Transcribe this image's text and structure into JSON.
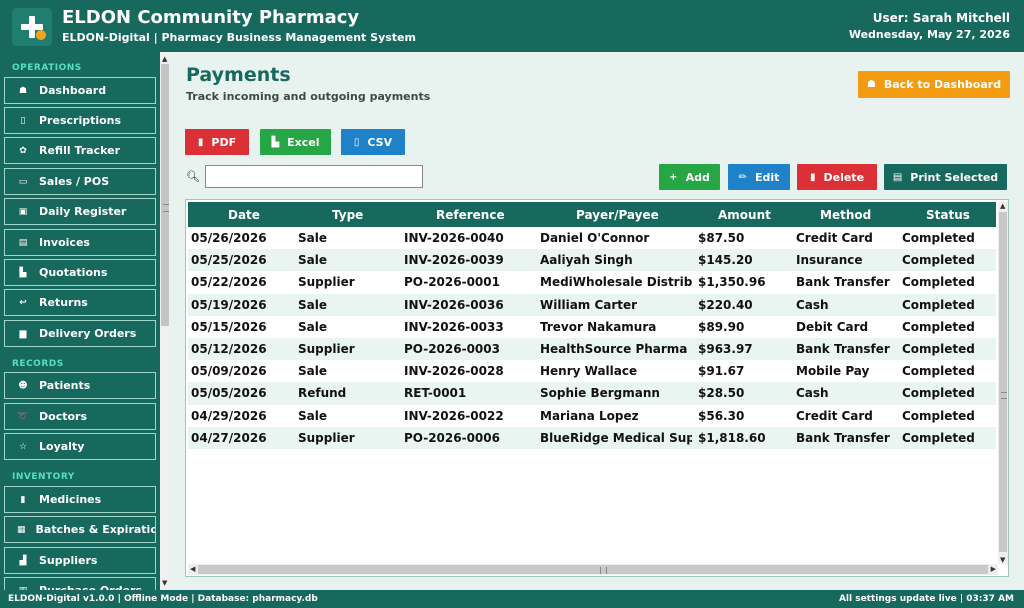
{
  "header": {
    "title": "ELDON Community Pharmacy",
    "subtitle": "ELDON-Digital  |  Pharmacy Business Management System",
    "user": "User: Sarah Mitchell",
    "date": "Wednesday, May 27, 2026"
  },
  "sidebar": {
    "sections": {
      "operations": "OPERATIONS",
      "records": "RECORDS",
      "inventory": "INVENTORY"
    },
    "items": [
      {
        "label": "Dashboard",
        "icon": "house-icon",
        "glyph": "☗"
      },
      {
        "label": "Prescriptions",
        "icon": "clipboard-icon",
        "glyph": "▯"
      },
      {
        "label": "Refill Tracker",
        "icon": "refresh-icon",
        "glyph": "✿"
      },
      {
        "label": "Sales / POS",
        "icon": "card-icon",
        "glyph": "▭"
      },
      {
        "label": "Daily Register",
        "icon": "register-icon",
        "glyph": "▣"
      },
      {
        "label": "Invoices",
        "icon": "invoice-icon",
        "glyph": "▤"
      },
      {
        "label": "Quotations",
        "icon": "quote-icon",
        "glyph": "▙"
      },
      {
        "label": "Returns",
        "icon": "return-icon",
        "glyph": "↩"
      },
      {
        "label": "Delivery Orders",
        "icon": "truck-icon",
        "glyph": "▆"
      },
      {
        "label": "Patients",
        "icon": "patients-icon",
        "glyph": "☻"
      },
      {
        "label": "Doctors",
        "icon": "stethoscope-icon",
        "glyph": "➰"
      },
      {
        "label": "Loyalty",
        "icon": "star-icon",
        "glyph": "☆"
      },
      {
        "label": "Medicines",
        "icon": "pill-icon",
        "glyph": "▮"
      },
      {
        "label": "Batches & Expiration",
        "icon": "batch-icon",
        "glyph": "▦"
      },
      {
        "label": "Suppliers",
        "icon": "factory-icon",
        "glyph": "▟"
      },
      {
        "label": "Purchase Orders",
        "icon": "cart-icon",
        "glyph": "▥"
      }
    ]
  },
  "page": {
    "title": "Payments",
    "subtitle": "Track incoming and outgoing payments",
    "back_label": "Back to Dashboard"
  },
  "export": {
    "pdf": "PDF",
    "excel": "Excel",
    "csv": "CSV"
  },
  "search": {
    "value": "",
    "placeholder": ""
  },
  "actions": {
    "add": "Add",
    "edit": "Edit",
    "delete": "Delete",
    "print": "Print Selected"
  },
  "table": {
    "columns": [
      "Date",
      "Type",
      "Reference",
      "Payer/Payee",
      "Amount",
      "Method",
      "Status"
    ],
    "rows": [
      [
        "05/26/2026",
        "Sale",
        "INV-2026-0040",
        "Daniel O'Connor",
        "$87.50",
        "Credit Card",
        "Completed"
      ],
      [
        "05/25/2026",
        "Sale",
        "INV-2026-0039",
        "Aaliyah Singh",
        "$145.20",
        "Insurance",
        "Completed"
      ],
      [
        "05/22/2026",
        "Supplier",
        "PO-2026-0001",
        "MediWholesale Distribut",
        "$1,350.96",
        "Bank Transfer",
        "Completed"
      ],
      [
        "05/19/2026",
        "Sale",
        "INV-2026-0036",
        "William Carter",
        "$220.40",
        "Cash",
        "Completed"
      ],
      [
        "05/15/2026",
        "Sale",
        "INV-2026-0033",
        "Trevor Nakamura",
        "$89.90",
        "Debit Card",
        "Completed"
      ],
      [
        "05/12/2026",
        "Supplier",
        "PO-2026-0003",
        "HealthSource Pharma",
        "$963.97",
        "Bank Transfer",
        "Completed"
      ],
      [
        "05/09/2026",
        "Sale",
        "INV-2026-0028",
        "Henry Wallace",
        "$91.67",
        "Mobile Pay",
        "Completed"
      ],
      [
        "05/05/2026",
        "Refund",
        "RET-0001",
        "Sophie Bergmann",
        "$28.50",
        "Cash",
        "Completed"
      ],
      [
        "04/29/2026",
        "Sale",
        "INV-2026-0022",
        "Mariana Lopez",
        "$56.30",
        "Credit Card",
        "Completed"
      ],
      [
        "04/27/2026",
        "Supplier",
        "PO-2026-0006",
        "BlueRidge Medical Supp",
        "$1,818.60",
        "Bank Transfer",
        "Completed"
      ]
    ]
  },
  "footer": {
    "left": "ELDON-Digital v1.0.0  |  Offline Mode  |  Database: pharmacy.db",
    "right": "All settings update live   |   03:37 AM"
  },
  "colors": {
    "primary": "#17695d",
    "accent_orange": "#f39c12",
    "red": "#dc3037",
    "green": "#27a645",
    "blue": "#1f82c9",
    "section_head": "#55e0bf"
  }
}
